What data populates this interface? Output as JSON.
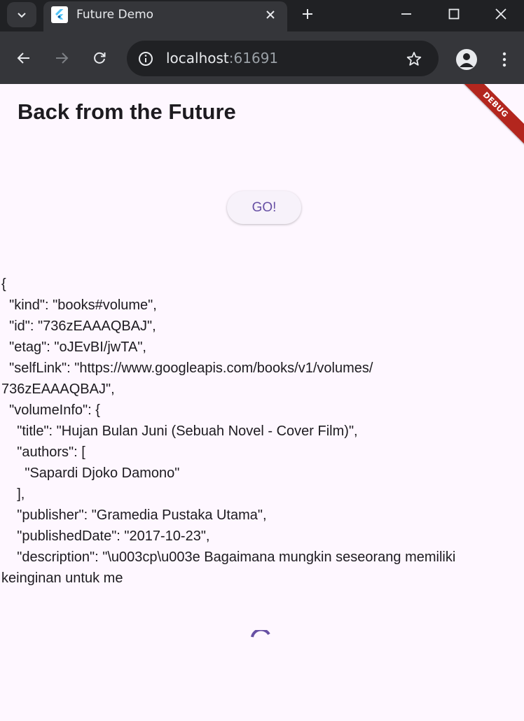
{
  "browser": {
    "tab_title": "Future Demo",
    "url_host": "localhost",
    "url_port": ":61691"
  },
  "app": {
    "title": "Back from the Future",
    "debug_banner": "DEBUG",
    "go_button": "GO!"
  },
  "json_lines": [
    "{",
    "  \"kind\": \"books#volume\",",
    "  \"id\": \"736zEAAAQBAJ\",",
    "  \"etag\": \"oJEvBI/jwTA\",",
    "  \"selfLink\": \"https://www.googleapis.com/books/v1/volumes/",
    "736zEAAAQBAJ\",",
    "  \"volumeInfo\": {",
    "    \"title\": \"Hujan Bulan Juni (Sebuah Novel - Cover Film)\",",
    "    \"authors\": [",
    "      \"Sapardi Djoko Damono\"",
    "    ],",
    "    \"publisher\": \"Gramedia Pustaka Utama\",",
    "    \"publishedDate\": \"2017-10-23\",",
    "    \"description\": \"\\u003cp\\u003e Bagaimana mungkin seseorang memiliki",
    "keinginan untuk me"
  ],
  "colors": {
    "page_background": "#fef7ff",
    "primary": "#6750a4",
    "debug_banner": "#b3261e"
  },
  "icons": {
    "tab_search": "chevron-down-icon",
    "favicon": "flutter-logo-icon",
    "back": "arrow-left-icon",
    "forward": "arrow-right-icon",
    "reload": "reload-icon",
    "site_info": "info-icon",
    "bookmark": "star-icon",
    "profile": "account-icon",
    "menu": "kebab-menu-icon"
  }
}
